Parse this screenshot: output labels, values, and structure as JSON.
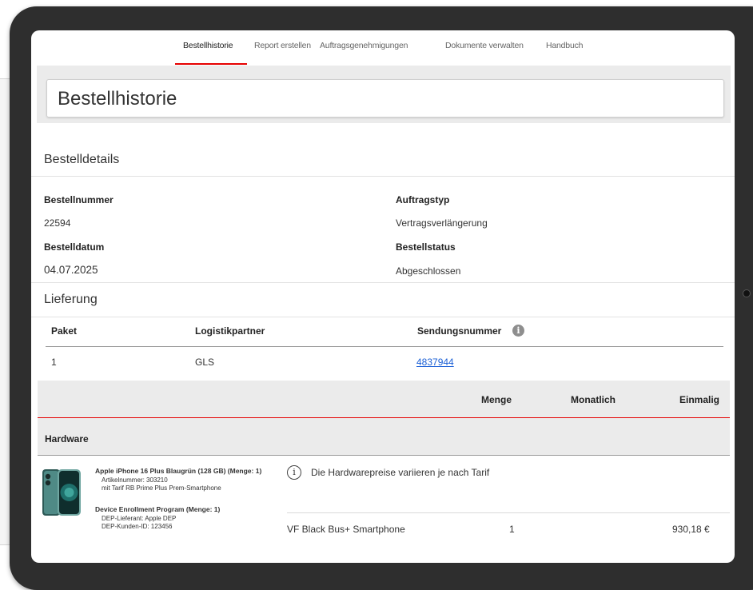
{
  "nav": {
    "tabs": [
      {
        "label": "Bestellhistorie",
        "active": true
      },
      {
        "label": "Report erstellen"
      },
      {
        "label": "Auftragsgenehmigungen"
      },
      {
        "label": "Dokumente verwalten"
      },
      {
        "label": "Handbuch"
      }
    ],
    "accent_color": "#e60000"
  },
  "page_title": "Bestellhistorie",
  "details": {
    "section_title": "Bestelldetails",
    "order_number_label": "Bestellnummer",
    "order_number": "22594",
    "order_date_label": "Bestelldatum",
    "order_date": "04.07.2025",
    "order_type_label": "Auftragstyp",
    "order_type": "Vertragsverlängerung",
    "order_status_label": "Bestellstatus",
    "order_status": "Abgeschlossen"
  },
  "delivery": {
    "section_title": "Lieferung",
    "columns": [
      "Paket",
      "Logistikpartner",
      "Sendungsnummer"
    ],
    "rows": [
      {
        "package": "1",
        "partner": "GLS",
        "tracking": "4837944"
      }
    ]
  },
  "order_table": {
    "columns": [
      "Menge",
      "Monatlich",
      "Einmalig"
    ],
    "group_label": "Hardware",
    "product": {
      "title": "Apple iPhone 16 Plus Blaugrün (128 GB) (Menge: 1)",
      "article": "Artikelnummer: 303210",
      "tariff": "mit Tarif RB Prime Plus Prem-Smartphone",
      "dep_title": "Device Enrollment Program (Menge: 1)",
      "dep_supplier": "DEP-Lieferant: Apple DEP",
      "dep_customer": "DEP-Kunden-ID: 123456",
      "price_note": "Die Hardwarepreise variieren je nach Tarif",
      "plan_name": "VF Black Bus+ Smartphone",
      "quantity": "1",
      "once_price": "930,18 €"
    }
  }
}
